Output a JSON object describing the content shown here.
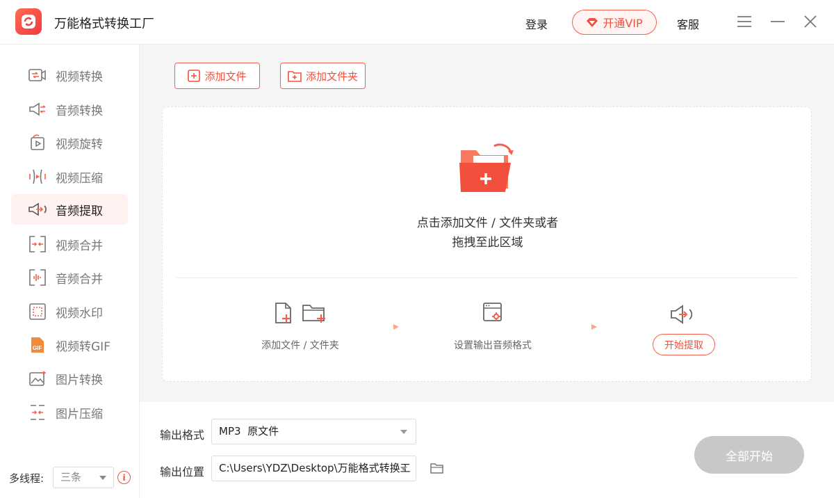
{
  "app": {
    "title": "万能格式转换工厂"
  },
  "header": {
    "login": "登录",
    "vip": "开通VIP",
    "service": "客服"
  },
  "sidebar": {
    "items": [
      {
        "label": "视频转换",
        "icon": "video-convert-icon",
        "active": false
      },
      {
        "label": "音频转换",
        "icon": "audio-convert-icon",
        "active": false
      },
      {
        "label": "视频旋转",
        "icon": "video-rotate-icon",
        "active": false
      },
      {
        "label": "视频压缩",
        "icon": "video-compress-icon",
        "active": false
      },
      {
        "label": "音频提取",
        "icon": "audio-extract-icon",
        "active": true
      },
      {
        "label": "视频合并",
        "icon": "video-merge-icon",
        "active": false
      },
      {
        "label": "音频合并",
        "icon": "audio-merge-icon",
        "active": false
      },
      {
        "label": "视频水印",
        "icon": "video-watermark-icon",
        "active": false
      },
      {
        "label": "视频转GIF",
        "icon": "video-to-gif-icon",
        "active": false
      },
      {
        "label": "图片转换",
        "icon": "image-convert-icon",
        "active": false
      },
      {
        "label": "图片压缩",
        "icon": "image-compress-icon",
        "active": false
      }
    ],
    "threads_label": "多线程:",
    "threads_value": "三条"
  },
  "toolbar": {
    "add_file": "添加文件",
    "add_folder": "添加文件夹"
  },
  "drop_zone": {
    "line1": "点击添加文件 / 文件夹或者",
    "line2": "拖拽至此区域",
    "steps": [
      {
        "label": "添加文件 / 文件夹"
      },
      {
        "label": "设置输出音频格式"
      },
      {
        "label": "开始提取"
      }
    ]
  },
  "output": {
    "format_label": "输出格式",
    "format_value": "MP3  原文件",
    "location_label": "输出位置",
    "location_value": "C:\\Users\\YDZ\\Desktop\\万能格式转换工"
  },
  "actions": {
    "start_all": "全部开始"
  },
  "colors": {
    "accent": "#f2503c",
    "active_bg": "#fff2f0",
    "disabled": "#c8c8c8"
  }
}
